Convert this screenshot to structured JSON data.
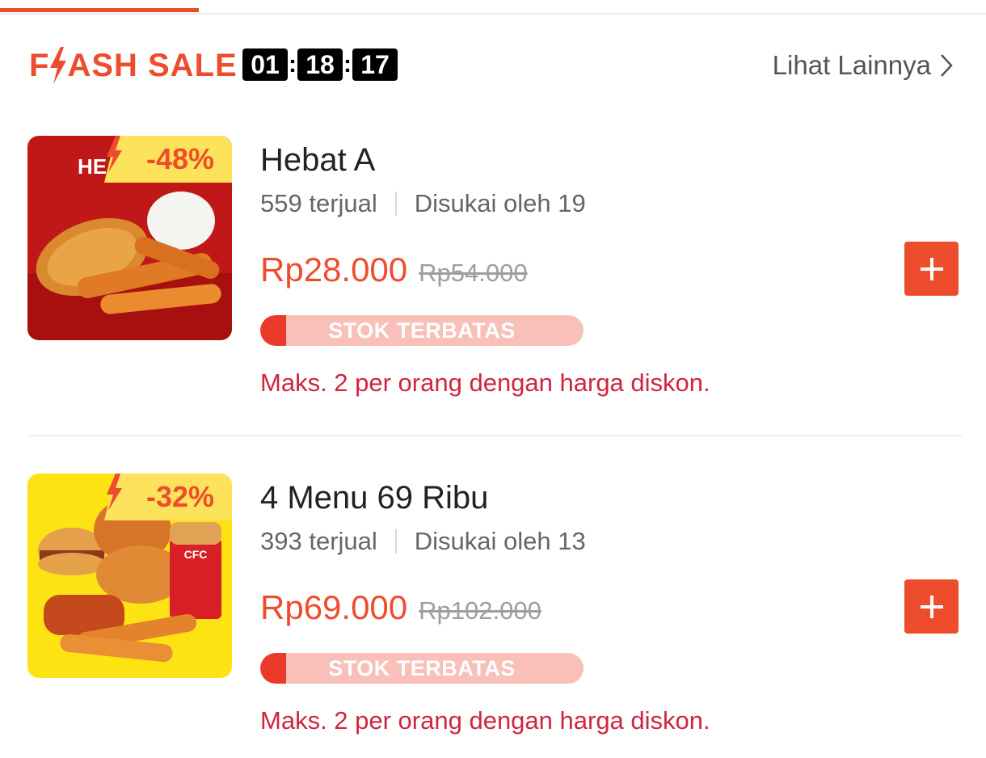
{
  "colors": {
    "brand": "#ee4d2d",
    "limit_text": "#d0253f",
    "countdown_bg": "#000000",
    "stock_track": "#f8c0b8",
    "stock_fill": "#ec3a2a"
  },
  "header": {
    "logo_part1": "F",
    "logo_part2": "ASH SALE",
    "logo_icon": "lightning-bolt-icon",
    "countdown": {
      "hours": "01",
      "minutes": "18",
      "seconds": "17",
      "separator": ":"
    },
    "see_more_label": "Lihat Lainnya",
    "see_more_icon": "chevron-right-icon"
  },
  "items": [
    {
      "name": "Hebat A",
      "sold": "559 terjual",
      "liked": "Disukai oleh 19",
      "discount": "-48%",
      "price": "Rp28.000",
      "original_price": "Rp54.000",
      "stock_label": "STOK TERBATAS",
      "stock_remaining": 0.08,
      "limit_note": "Maks. 2 per orang dengan harga diskon.",
      "add_icon": "plus-icon",
      "image": "fried-chicken-rice-image",
      "image_bg": "#c01818",
      "image_text": "HE"
    },
    {
      "name": "4 Menu 69 Ribu",
      "sold": "393 terjual",
      "liked": "Disukai oleh 13",
      "discount": "-32%",
      "price": "Rp69.000",
      "original_price": "Rp102.000",
      "stock_label": "STOK TERBATAS",
      "stock_remaining": 0.08,
      "limit_note": "Maks. 2 per orang dengan harga diskon.",
      "add_icon": "plus-icon",
      "image": "combo-meal-image",
      "image_bg": "#fde314",
      "image_text": "CFC"
    }
  ]
}
